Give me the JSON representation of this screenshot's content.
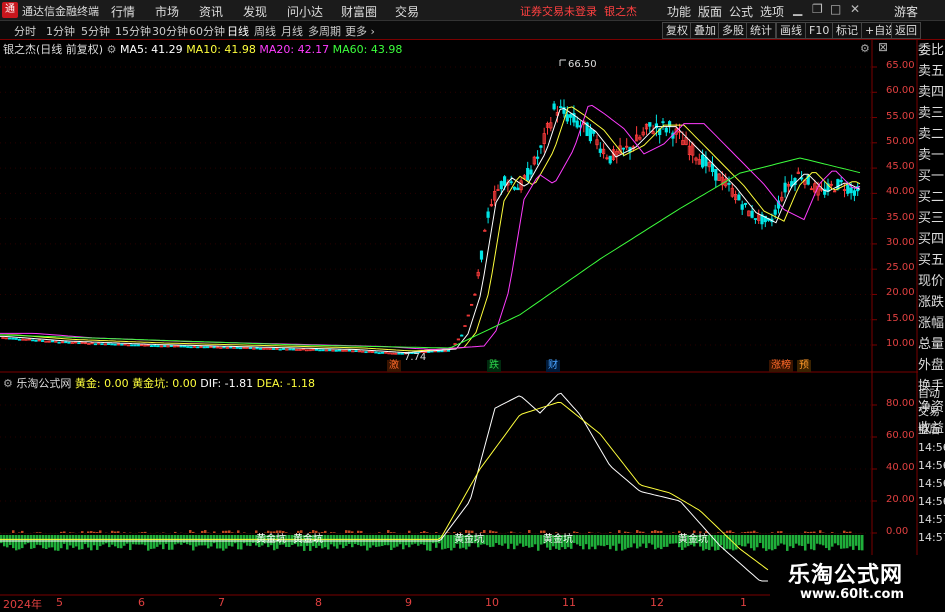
{
  "titlebar": {
    "app_name": "通达信金融终端",
    "menus": [
      "行情",
      "市场",
      "资讯",
      "发现",
      "问小达",
      "财富圈",
      "交易"
    ],
    "warning": "证券交易未登录",
    "stock_name": "银之杰",
    "right_menus": [
      "功能",
      "版面",
      "公式",
      "选项"
    ],
    "guest": "游客"
  },
  "toolbar": {
    "periods": [
      "分时",
      "1分钟",
      "5分钟",
      "15分钟",
      "30分钟",
      "60分钟",
      "日线",
      "周线",
      "月线",
      "多周期",
      "更多"
    ],
    "active_period": "日线",
    "right_buttons": [
      "复权",
      "叠加",
      "多股",
      "统计",
      "画线",
      "F10",
      "标记",
      "+自选",
      "返回"
    ]
  },
  "main_info": {
    "stock": "银之杰(日线 前复权)",
    "ma5": "MA5: 41.29",
    "ma10": "MA10: 41.98",
    "ma20": "MA20: 42.17",
    "ma60": "MA60: 43.98"
  },
  "sub_info": {
    "formula": "乐淘公式网",
    "gold": "黄金: 0.00",
    "gold_pit": "黄金坑: 0.00",
    "dif": "DIF: -1.81",
    "dea": "DEA: -1.18"
  },
  "price_axis": [
    "65.00",
    "60.00",
    "55.00",
    "50.00",
    "45.00",
    "40.00",
    "35.00",
    "30.00",
    "25.00",
    "20.00",
    "15.00",
    "10.00"
  ],
  "sub_axis": [
    "80.00",
    "60.00",
    "40.00",
    "20.00",
    "0.00"
  ],
  "annotations": {
    "high": "66.50",
    "low": "7.74"
  },
  "events": [
    {
      "label": "激",
      "color": "#ff6a2a"
    },
    {
      "label": "跌",
      "color": "#2bd44b"
    },
    {
      "label": "财",
      "color": "#4aa3ff"
    },
    {
      "label": "涨榜",
      "color": "#ff6a2a"
    },
    {
      "label": "预",
      "color": "#ff9a2a"
    }
  ],
  "gold_pit_labels": [
    "黄金坑",
    "黄金坑",
    "黄金坑",
    "黄金坑",
    "黄金坑"
  ],
  "x_axis": [
    "2024年",
    "5",
    "6",
    "7",
    "8",
    "9",
    "10",
    "11",
    "12",
    "1"
  ],
  "sidebar": [
    "委比",
    "卖五",
    "卖四",
    "卖三",
    "卖二",
    "卖一",
    "买一",
    "买二",
    "买三",
    "买四",
    "买五",
    "现价",
    "涨跌",
    "涨幅",
    "总量",
    "外盘",
    "换手",
    "净资",
    "收益"
  ],
  "sidebar2": [
    "自动",
    "交易",
    "盘后",
    "14:56",
    "14:56",
    "14:56",
    "14:56",
    "14:57",
    "14:57"
  ],
  "watermark": {
    "name": "乐淘公式网",
    "url": "www.60lt.com"
  },
  "colors": {
    "up": "#ff3c3c",
    "down": "#00e5e5",
    "ma5": "#ffffff",
    "ma10": "#ffff3c",
    "ma20": "#ff3cff",
    "ma60": "#3cff3c"
  }
}
